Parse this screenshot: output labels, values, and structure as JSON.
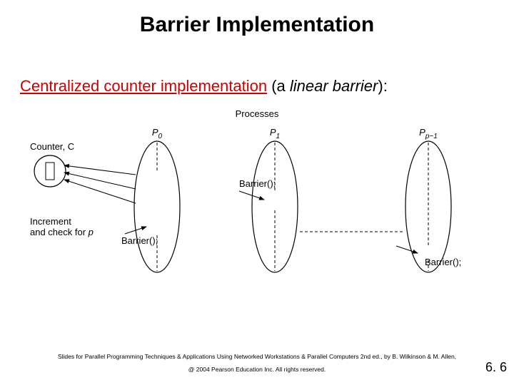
{
  "title": "Barrier Implementation",
  "subtitle": {
    "underlined": "Centralized counter implementation",
    "paren_prefix": " (a ",
    "linear": "linear barrier",
    "paren_suffix": "):"
  },
  "diagram": {
    "top_label": "Processes",
    "counter_label": "Counter, C",
    "p0": "P",
    "p0_sub": "0",
    "p1": "P",
    "p1_sub": "1",
    "pp": "P",
    "pp_sub": "p−1",
    "increment_line1": "Increment",
    "increment_line2": "and check for ",
    "increment_p": "p",
    "barrier_call": "Barrier();"
  },
  "footer": {
    "line1": "Slides for Parallel Programming Techniques & Applications Using Networked Workstations & Parallel Computers 2nd ed., by B. Wilkinson & M. Allen,",
    "line2": "@ 2004 Pearson Education Inc. All rights reserved."
  },
  "page_number": "6. 6"
}
